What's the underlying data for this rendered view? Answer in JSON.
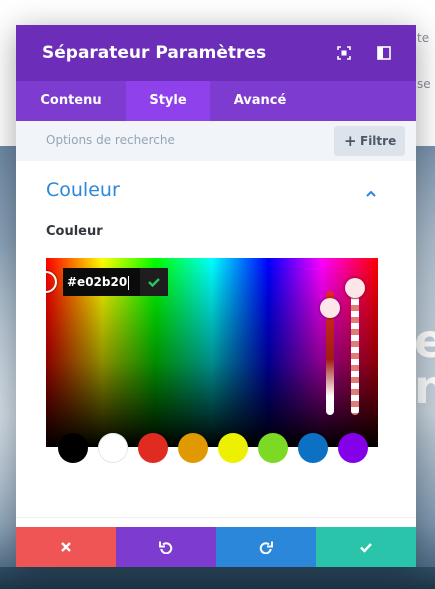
{
  "background": {
    "side_text_1": "te",
    "side_text_2": "se",
    "big_text_1": "e",
    "big_text_2": "n"
  },
  "modal": {
    "title": "Séparateur Paramètres",
    "header_icons": [
      "expand-icon",
      "sidebar-toggle-icon"
    ],
    "tabs": [
      {
        "label": "Contenu",
        "active": false
      },
      {
        "label": "Style",
        "active": true
      },
      {
        "label": "Avancé",
        "active": false
      }
    ],
    "search": {
      "placeholder": "Options de recherche",
      "filter_label": "Filtre"
    },
    "section": {
      "title": "Couleur",
      "expanded": true,
      "field_label": "Couleur"
    },
    "color_picker": {
      "hex_value": "#e02b20",
      "swatches": [
        "#000000",
        "#ffffff",
        "#e02b20",
        "#e09900",
        "#edf000",
        "#7cda24",
        "#0c71c3",
        "#8300e9"
      ]
    },
    "footer_buttons": [
      {
        "name": "discard",
        "icon": "close-icon",
        "color": "#ef5555"
      },
      {
        "name": "undo",
        "icon": "undo-icon",
        "color": "#7e3bd0"
      },
      {
        "name": "redo",
        "icon": "redo-icon",
        "color": "#2b87da"
      },
      {
        "name": "save",
        "icon": "check-icon",
        "color": "#29c4a9"
      }
    ]
  },
  "colors": {
    "header": "#6c2eb9",
    "tabs": "#7e3bd0",
    "tab_active": "#8f42ec",
    "accent_blue": "#2b87da"
  }
}
